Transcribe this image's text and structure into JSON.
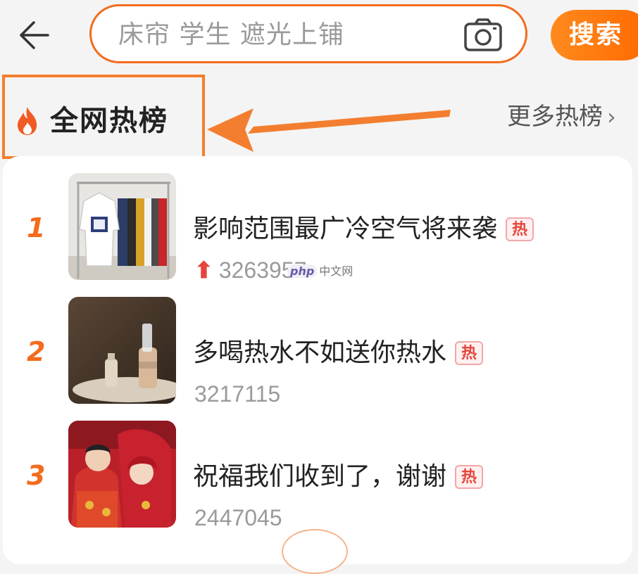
{
  "header": {
    "search_placeholder": "床帘 学生 遮光上铺",
    "search_button": "搜索"
  },
  "hot_list": {
    "title": "全网热榜",
    "more_label": "更多热榜",
    "items": [
      {
        "rank": "1",
        "title": "影响范围最广冷空气将来袭",
        "tag": "热",
        "count": "3263957",
        "rising": true
      },
      {
        "rank": "2",
        "title": "多喝热水不如送你热水",
        "tag": "热",
        "count": "3217115",
        "rising": false
      },
      {
        "rank": "3",
        "title": "祝福我们收到了，谢谢",
        "tag": "热",
        "count": "2447045",
        "rising": false
      }
    ]
  },
  "watermark": {
    "badge": "php",
    "text": "中文网"
  },
  "colors": {
    "accent": "#f36b1c",
    "hot_tag": "#e5463c"
  }
}
